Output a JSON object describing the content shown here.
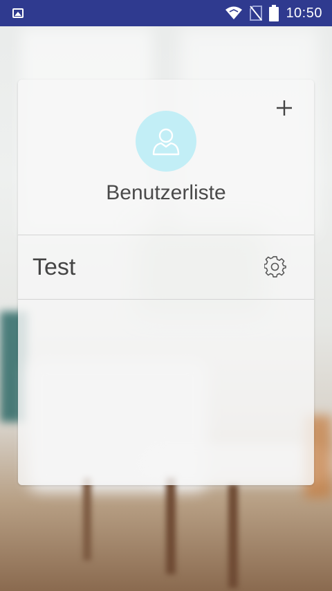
{
  "status_bar": {
    "time": "10:50",
    "icons": [
      "image-notification-icon",
      "wifi-icon",
      "no-sim-icon",
      "battery-icon"
    ],
    "color": "#2f3a8f"
  },
  "card": {
    "title": "Benutzerliste",
    "add_icon": "plus-icon",
    "avatar_icon": "user-avatar-icon",
    "avatar_color": "#c2eef6",
    "users": [
      {
        "name": "Test",
        "settings_icon": "gear-icon"
      }
    ]
  }
}
